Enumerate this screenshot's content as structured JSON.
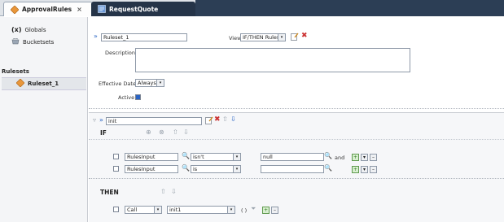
{
  "tabs": {
    "approval": "ApprovalRules",
    "request": "RequestQuote",
    "close": "×"
  },
  "sidebar": {
    "globals": "Globals",
    "globals_icon": "(x)",
    "bucketsets": "Bucketsets",
    "rulesets_header": "Rulesets",
    "ruleset_1": "Ruleset_1"
  },
  "ruleset": {
    "name_value": "Ruleset_1",
    "view_label": "View",
    "view_value": "IF/THEN Rules",
    "description_label": "Description",
    "effective_date_label": "Effective Date",
    "effective_date_value": "Always",
    "active_label": "Active"
  },
  "rule": {
    "name_value": "init",
    "if_label": "IF",
    "then_label": "THEN",
    "conditions": [
      {
        "left": "RulesInput",
        "op": "isn't",
        "right": "null",
        "join": "and"
      },
      {
        "left": "RulesInput",
        "op": "is",
        "right": "",
        "join": ""
      }
    ],
    "action": {
      "type": "Call",
      "target": "init1",
      "parens": "( )"
    }
  },
  "colors": {
    "tab_dark": "#253448",
    "accent_blue": "#2a64c4",
    "delete_red": "#cc3333"
  },
  "icons": {
    "search": "🔍",
    "plus": "+",
    "minus": "–",
    "dropdown": "▾",
    "up": "⇧",
    "down": "⇩",
    "collapse": "▿",
    "expand": "»"
  }
}
